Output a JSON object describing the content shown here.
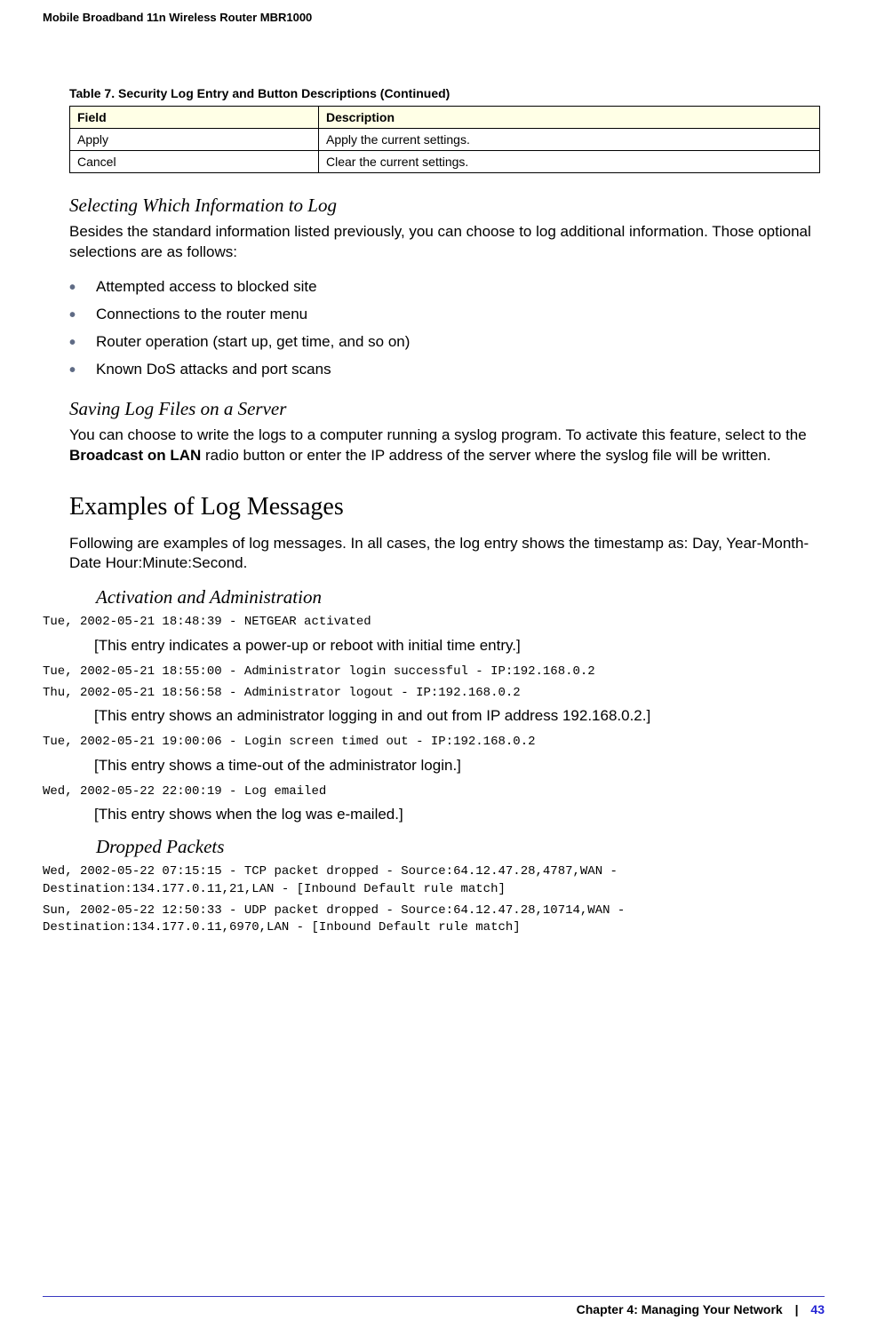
{
  "header": {
    "title": "Mobile Broadband 11n Wireless Router MBR1000"
  },
  "table": {
    "caption": "Table 7.  Security Log Entry and Button Descriptions  (Continued)",
    "headers": [
      "Field",
      "Description"
    ],
    "rows": [
      {
        "field": "Apply",
        "desc": "Apply the current settings."
      },
      {
        "field": "Cancel",
        "desc": "Clear the current settings."
      }
    ]
  },
  "section_select": {
    "title": "Selecting Which Information to Log",
    "body": "Besides the standard information listed previously, you can choose to log additional information. Those optional selections are as follows:",
    "items": [
      "Attempted access to blocked site",
      "Connections to the router menu",
      "Router operation (start up, get time, and so on)",
      "Known DoS attacks and port scans"
    ]
  },
  "section_saving": {
    "title": "Saving Log Files on a Server",
    "body_before": "You can choose to write the logs to a computer running a syslog program. To activate this feature, select to the ",
    "bold": "Broadcast on LAN",
    "body_after": " radio button or enter the IP address of the server where the syslog file will be written."
  },
  "section_examples": {
    "title": "Examples of Log Messages",
    "body": "Following are examples of log messages. In all cases, the log entry shows the timestamp as: Day, Year-Month-Date  Hour:Minute:Second."
  },
  "activation": {
    "title": "Activation and Administration",
    "log1": "Tue, 2002-05-21 18:48:39 - NETGEAR activated",
    "exp1": "[This entry indicates a power-up or reboot with initial time entry.]",
    "log2a": "Tue, 2002-05-21 18:55:00 - Administrator login successful - IP:192.168.0.2",
    "log2b": "Thu, 2002-05-21 18:56:58 - Administrator logout - IP:192.168.0.2",
    "exp2": "[This entry shows an administrator logging in and out from IP address 192.168.0.2.]",
    "log3": "Tue, 2002-05-21 19:00:06 - Login screen timed out - IP:192.168.0.2",
    "exp3": "[This entry shows a time-out of the administrator login.]",
    "log4": "Wed, 2002-05-22 22:00:19 - Log emailed",
    "exp4": "[This entry shows when the log was e-mailed.]"
  },
  "dropped": {
    "title": "Dropped Packets",
    "log1": "Wed, 2002-05-22 07:15:15 - TCP packet dropped - Source:64.12.47.28,4787,WAN - Destination:134.177.0.11,21,LAN - [Inbound Default rule match]",
    "log2": "Sun, 2002-05-22 12:50:33 - UDP packet dropped - Source:64.12.47.28,10714,WAN - Destination:134.177.0.11,6970,LAN - [Inbound Default rule match]"
  },
  "footer": {
    "chapter": "Chapter 4:  Managing Your Network",
    "separator": "|",
    "page": "43"
  }
}
